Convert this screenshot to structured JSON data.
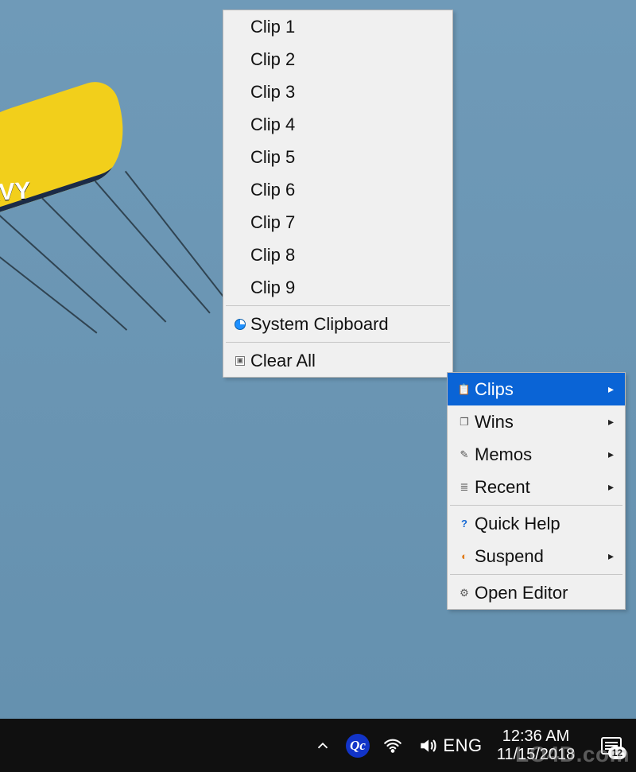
{
  "wing_text": "NAVY",
  "clips_menu": {
    "items": [
      {
        "label": "Clip 1"
      },
      {
        "label": "Clip 2"
      },
      {
        "label": "Clip 3"
      },
      {
        "label": "Clip 4"
      },
      {
        "label": "Clip 5"
      },
      {
        "label": "Clip 6"
      },
      {
        "label": "Clip 7"
      },
      {
        "label": "Clip 8"
      },
      {
        "label": "Clip 9"
      }
    ],
    "system_clipboard_label": "System Clipboard",
    "clear_all_label": "Clear All"
  },
  "main_menu": {
    "clips_label": "Clips",
    "wins_label": "Wins",
    "memos_label": "Memos",
    "recent_label": "Recent",
    "quick_help_label": "Quick Help",
    "suspend_label": "Suspend",
    "open_editor_label": "Open Editor"
  },
  "taskbar": {
    "qc_text": "Qc",
    "language": "ENG",
    "time": "12:36 AM",
    "date": "11/15/2018",
    "notification_count": "12"
  },
  "watermark": "LO4D.com"
}
